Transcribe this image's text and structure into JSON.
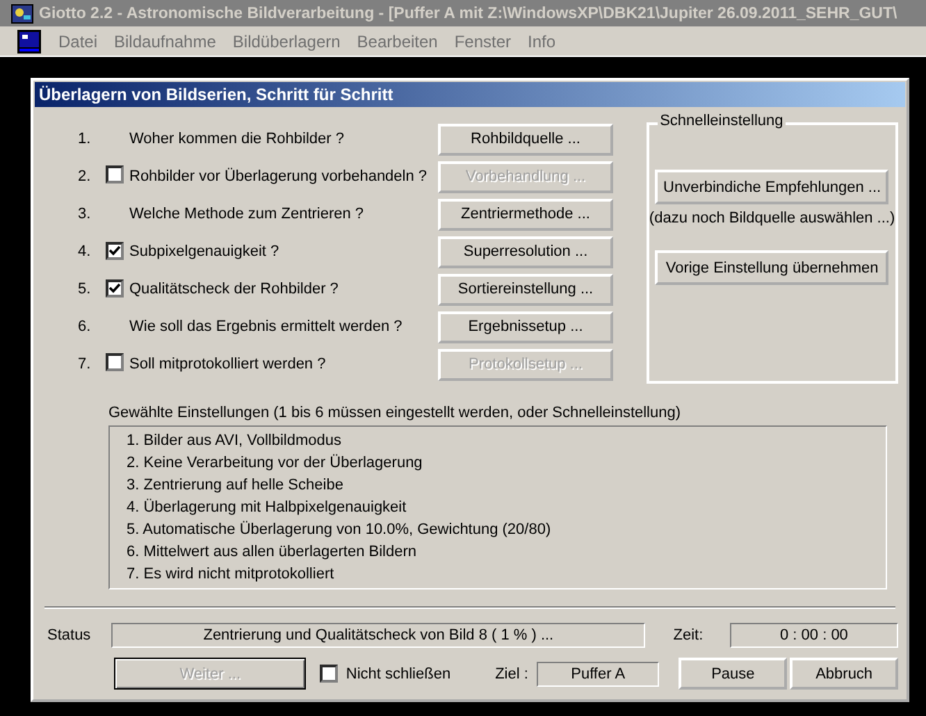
{
  "app": {
    "title": "Giotto 2.2 - Astronomische Bildverarbeitung - [Puffer A mit Z:\\WindowsXP\\DBK21\\Jupiter 26.09.2011_SEHR_GUT\\",
    "menu": [
      "Datei",
      "Bildaufnahme",
      "Bildüberlagern",
      "Bearbeiten",
      "Fenster",
      "Info"
    ]
  },
  "dialog": {
    "title": "Überlagern von Bildserien, Schritt für Schritt",
    "steps": [
      {
        "number": "1.",
        "kind": "plain",
        "question": "Woher kommen die Rohbilder ?",
        "button": {
          "label": "Rohbildquelle ...",
          "disabled": false
        }
      },
      {
        "number": "2.",
        "kind": "checkbox",
        "checked": false,
        "question": "Rohbilder vor Überlagerung vorbehandeln ?",
        "button": {
          "label": "Vorbehandlung ...",
          "disabled": true
        }
      },
      {
        "number": "3.",
        "kind": "plain",
        "question": "Welche Methode zum Zentrieren ?",
        "button": {
          "label": "Zentriermethode ...",
          "disabled": false
        }
      },
      {
        "number": "4.",
        "kind": "checkbox",
        "checked": true,
        "question": "Subpixelgenauigkeit ?",
        "button": {
          "label": "Superresolution ...",
          "disabled": false
        }
      },
      {
        "number": "5.",
        "kind": "checkbox",
        "checked": true,
        "question": "Qualitätscheck der Rohbilder ?",
        "button": {
          "label": "Sortiereinstellung ...",
          "disabled": false
        }
      },
      {
        "number": "6.",
        "kind": "plain",
        "question": "Wie soll das Ergebnis ermittelt werden ?",
        "button": {
          "label": "Ergebnissetup ...",
          "disabled": false
        }
      },
      {
        "number": "7.",
        "kind": "checkbox",
        "checked": false,
        "question": "Soll mitprotokolliert werden ?",
        "button": {
          "label": "Protokollsetup ...",
          "disabled": true
        }
      }
    ],
    "quick_settings": {
      "title": "Schnelleinstellung",
      "recommend_button": "Unverbindiche Empfehlungen ...",
      "hint": "(dazu noch Bildquelle auswählen ...)",
      "previous_button": "Vorige Einstellung übernehmen"
    },
    "summary": {
      "label": "Gewählte Einstellungen (1 bis 6 müssen eingestellt werden, oder Schnelleinstellung)",
      "lines": [
        "1. Bilder aus AVI, Vollbildmodus",
        "2. Keine Verarbeitung vor der Überlagerung",
        "3. Zentrierung auf helle Scheibe",
        "4. Überlagerung mit Halbpixelgenauigkeit",
        "5. Automatische Überlagerung von 10.0%, Gewichtung (20/80)",
        "6. Mittelwert aus allen überlagerten Bildern",
        "7. Es wird nicht mitprotokolliert"
      ]
    },
    "status": {
      "label": "Status",
      "text": "Zentrierung und Qualitätscheck von Bild 8 ( 1 % ) ...",
      "time_label": "Zeit:",
      "time": "0 : 00 : 00"
    },
    "footer": {
      "next_button": {
        "label": "Weiter ...",
        "disabled": true
      },
      "keep_open": {
        "label": "Nicht schließen",
        "checked": false
      },
      "target_label": "Ziel :",
      "target": "Puffer A",
      "pause_button": "Pause",
      "abort_button": "Abbruch"
    }
  }
}
